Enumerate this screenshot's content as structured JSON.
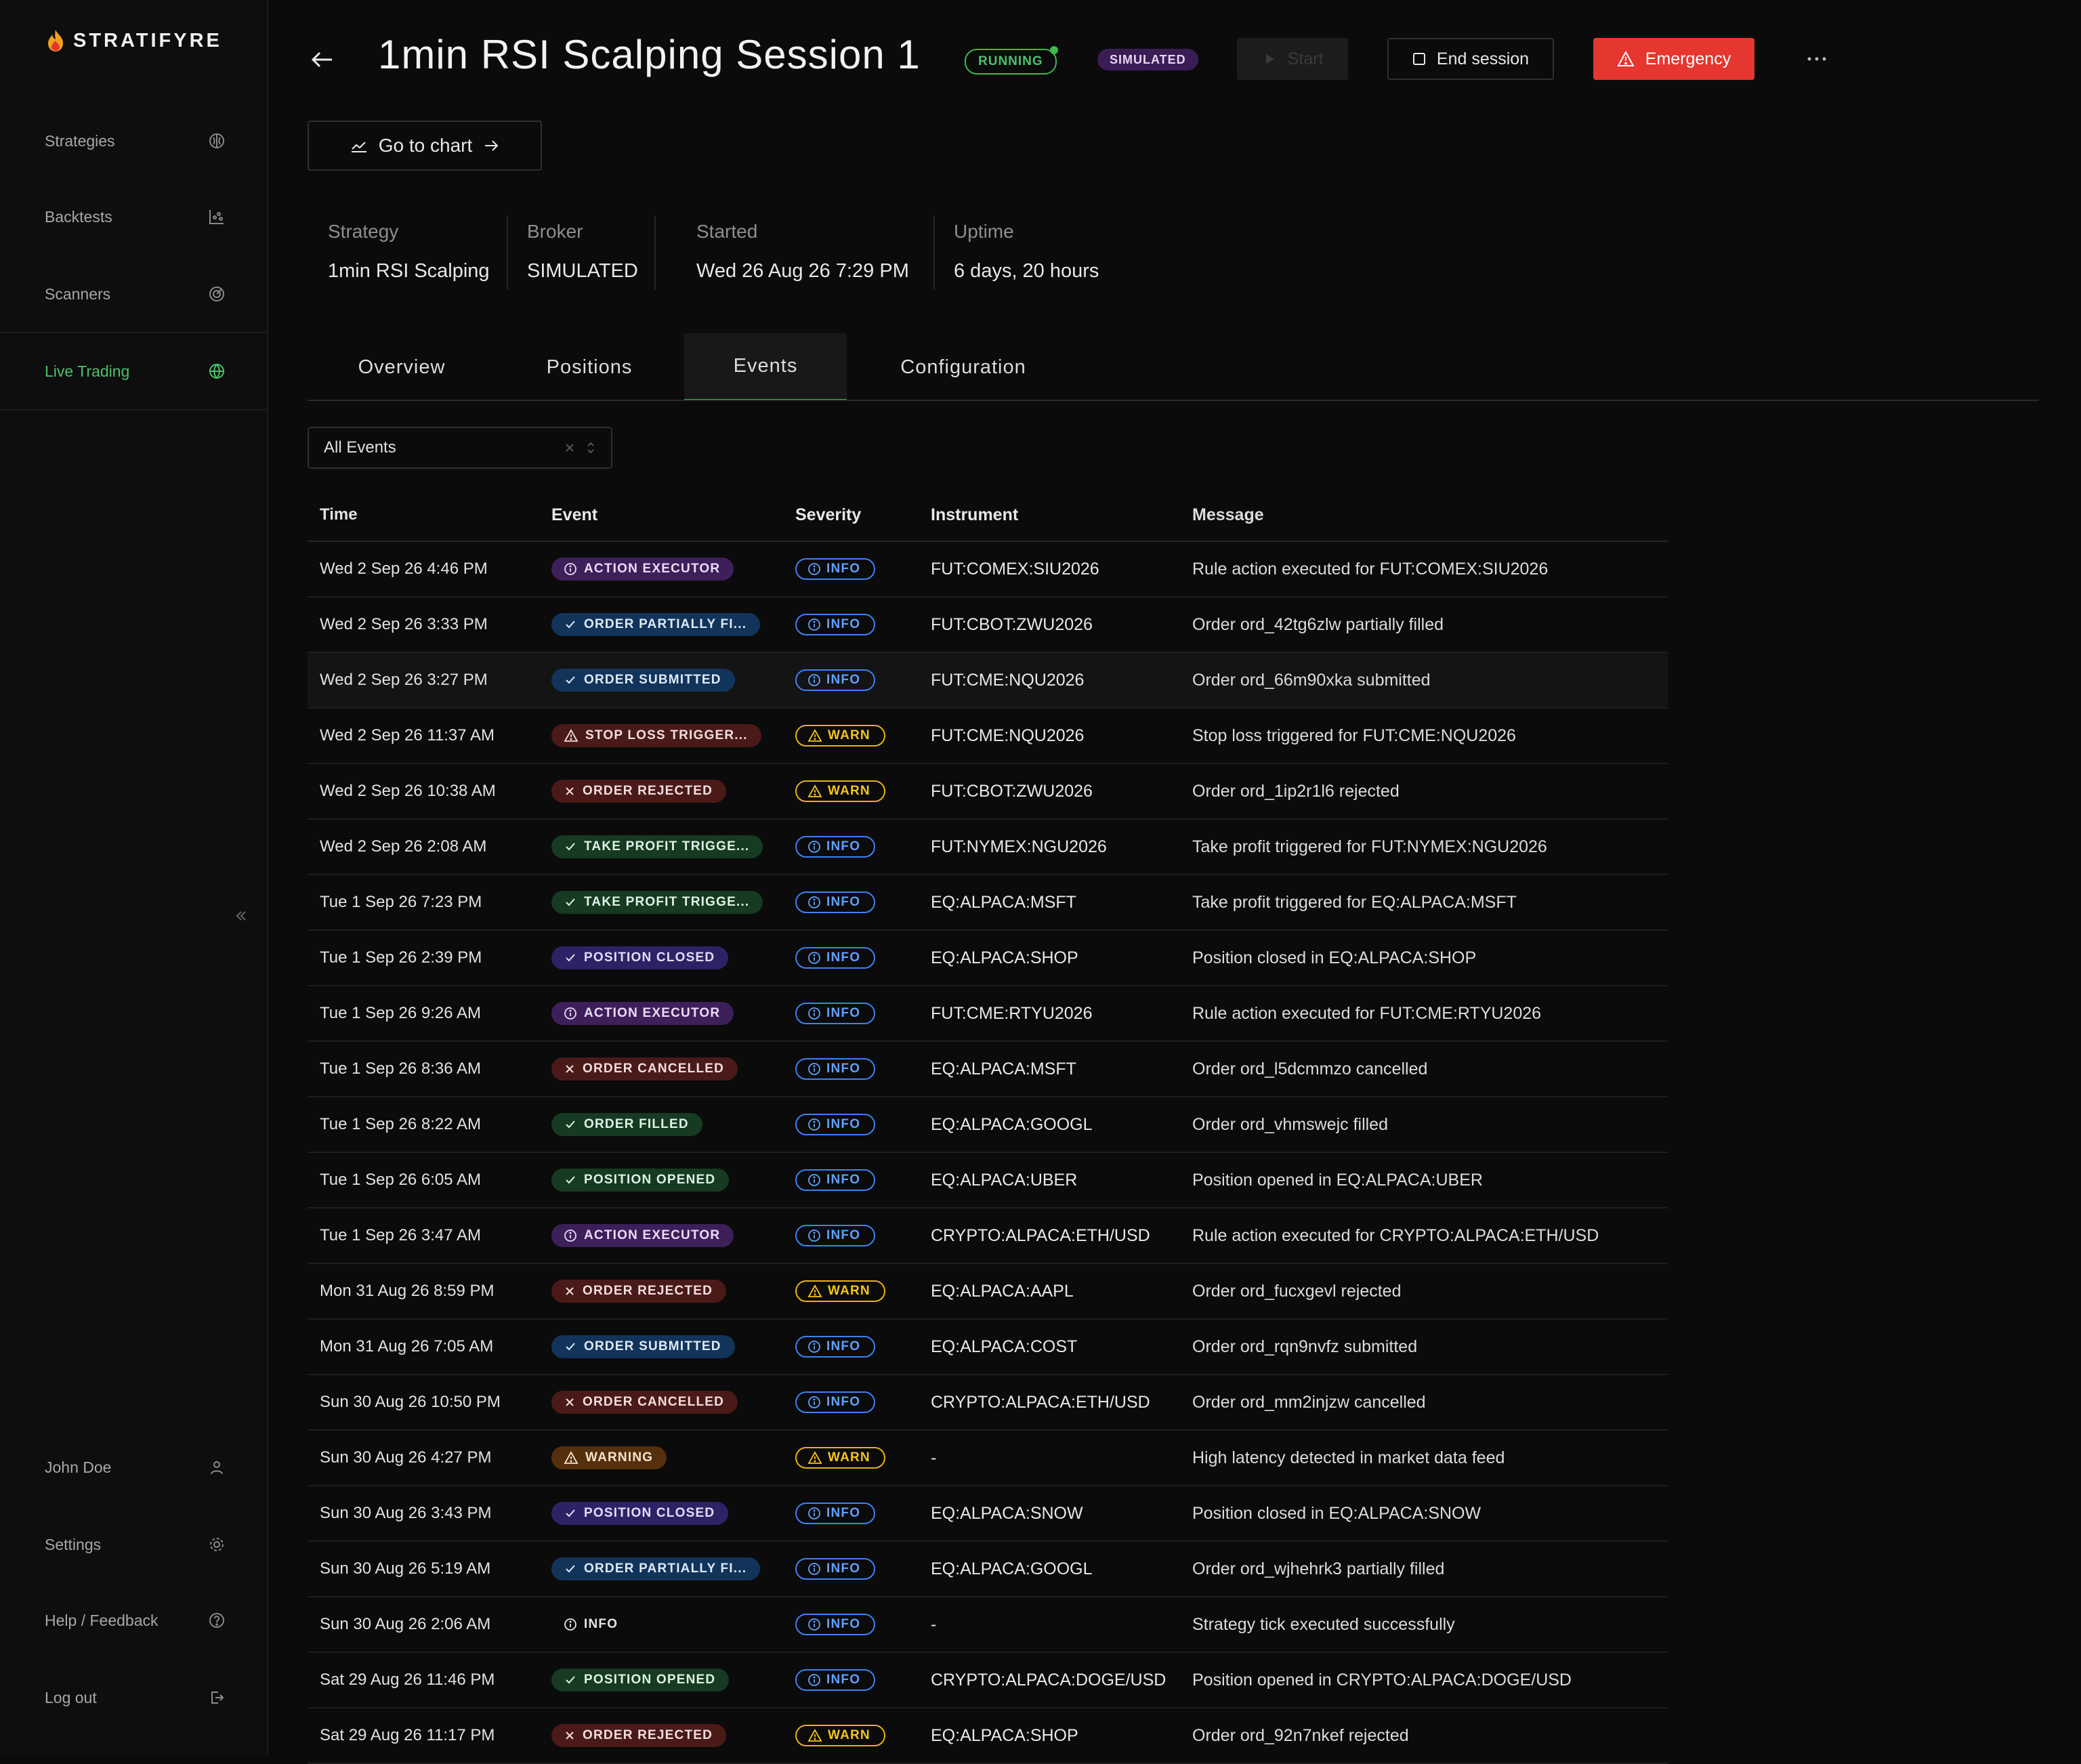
{
  "app": {
    "brand": "STRATIFYRE",
    "accent": "#3fb950",
    "danger": "#e5362f"
  },
  "sidebar": {
    "items": [
      {
        "label": "Strategies",
        "icon": "brain-icon"
      },
      {
        "label": "Backtests",
        "icon": "chart-scatter-icon"
      },
      {
        "label": "Scanners",
        "icon": "radar-icon"
      },
      {
        "label": "Live Trading",
        "icon": "globe-icon",
        "active": true
      }
    ],
    "bottom": [
      {
        "label": "John Doe",
        "icon": "user-icon"
      },
      {
        "label": "Settings",
        "icon": "gear-icon"
      },
      {
        "label": "Help / Feedback",
        "icon": "help-circle-icon"
      },
      {
        "label": "Log out",
        "icon": "logout-icon"
      }
    ]
  },
  "header": {
    "title": "1min RSI Scalping Session 1",
    "status": "RUNNING",
    "mode": "SIMULATED",
    "start_label": "Start",
    "end_label": "End session",
    "emergency_label": "Emergency",
    "chart_label": "Go to chart"
  },
  "info": [
    {
      "label": "Strategy",
      "value": "1min RSI Scalping"
    },
    {
      "label": "Broker",
      "value": "SIMULATED"
    },
    {
      "label": "Started",
      "value": "Wed 26 Aug 26 7:29 PM"
    },
    {
      "label": "Uptime",
      "value": "6 days, 20 hours"
    }
  ],
  "tabs": [
    "Overview",
    "Positions",
    "Events",
    "Configuration"
  ],
  "active_tab": "Events",
  "filter": {
    "value": "All Events"
  },
  "table": {
    "columns": [
      "Time",
      "Event",
      "Severity",
      "Instrument",
      "Message"
    ],
    "rows": [
      {
        "time": "Wed 2 Sep 26 4:46 PM",
        "event": "ACTION EXECUTOR",
        "kind": "action",
        "severity": "INFO",
        "instrument": "FUT:COMEX:SIU2026",
        "message": "Rule action executed for FUT:COMEX:SIU2026"
      },
      {
        "time": "Wed 2 Sep 26 3:33 PM",
        "event": "ORDER PARTIALLY FI...",
        "kind": "partial",
        "severity": "INFO",
        "instrument": "FUT:CBOT:ZWU2026",
        "message": "Order ord_42tg6zlw partially filled"
      },
      {
        "time": "Wed 2 Sep 26 3:27 PM",
        "event": "ORDER SUBMITTED",
        "kind": "submitted",
        "severity": "INFO",
        "instrument": "FUT:CME:NQU2026",
        "message": "Order ord_66m90xka submitted"
      },
      {
        "time": "Wed 2 Sep 26 11:37 AM",
        "event": "STOP LOSS TRIGGER...",
        "kind": "stoploss",
        "severity": "WARN",
        "instrument": "FUT:CME:NQU2026",
        "message": "Stop loss triggered for FUT:CME:NQU2026"
      },
      {
        "time": "Wed 2 Sep 26 10:38 AM",
        "event": "ORDER REJECTED",
        "kind": "rejected",
        "severity": "WARN",
        "instrument": "FUT:CBOT:ZWU2026",
        "message": "Order ord_1ip2r1l6 rejected"
      },
      {
        "time": "Wed 2 Sep 26 2:08 AM",
        "event": "TAKE PROFIT TRIGGE...",
        "kind": "takeprofit",
        "severity": "INFO",
        "instrument": "FUT:NYMEX:NGU2026",
        "message": "Take profit triggered for FUT:NYMEX:NGU2026"
      },
      {
        "time": "Tue 1 Sep 26 7:23 PM",
        "event": "TAKE PROFIT TRIGGE...",
        "kind": "takeprofit",
        "severity": "INFO",
        "instrument": "EQ:ALPACA:MSFT",
        "message": "Take profit triggered for EQ:ALPACA:MSFT"
      },
      {
        "time": "Tue 1 Sep 26 2:39 PM",
        "event": "POSITION CLOSED",
        "kind": "closed",
        "severity": "INFO",
        "instrument": "EQ:ALPACA:SHOP",
        "message": "Position closed in EQ:ALPACA:SHOP"
      },
      {
        "time": "Tue 1 Sep 26 9:26 AM",
        "event": "ACTION EXECUTOR",
        "kind": "action",
        "severity": "INFO",
        "instrument": "FUT:CME:RTYU2026",
        "message": "Rule action executed for FUT:CME:RTYU2026"
      },
      {
        "time": "Tue 1 Sep 26 8:36 AM",
        "event": "ORDER CANCELLED",
        "kind": "cancelled",
        "severity": "INFO",
        "instrument": "EQ:ALPACA:MSFT",
        "message": "Order ord_l5dcmmzo cancelled"
      },
      {
        "time": "Tue 1 Sep 26 8:22 AM",
        "event": "ORDER FILLED",
        "kind": "filled",
        "severity": "INFO",
        "instrument": "EQ:ALPACA:GOOGL",
        "message": "Order ord_vhmswejc filled"
      },
      {
        "time": "Tue 1 Sep 26 6:05 AM",
        "event": "POSITION OPENED",
        "kind": "opened",
        "severity": "INFO",
        "instrument": "EQ:ALPACA:UBER",
        "message": "Position opened in EQ:ALPACA:UBER"
      },
      {
        "time": "Tue 1 Sep 26 3:47 AM",
        "event": "ACTION EXECUTOR",
        "kind": "action",
        "severity": "INFO",
        "instrument": "CRYPTO:ALPACA:ETH/USD",
        "message": "Rule action executed for CRYPTO:ALPACA:ETH/USD"
      },
      {
        "time": "Mon 31 Aug 26 8:59 PM",
        "event": "ORDER REJECTED",
        "kind": "rejected",
        "severity": "WARN",
        "instrument": "EQ:ALPACA:AAPL",
        "message": "Order ord_fucxgevl rejected"
      },
      {
        "time": "Mon 31 Aug 26 7:05 AM",
        "event": "ORDER SUBMITTED",
        "kind": "submitted",
        "severity": "INFO",
        "instrument": "EQ:ALPACA:COST",
        "message": "Order ord_rqn9nvfz submitted"
      },
      {
        "time": "Sun 30 Aug 26 10:50 PM",
        "event": "ORDER CANCELLED",
        "kind": "cancelled",
        "severity": "INFO",
        "instrument": "CRYPTO:ALPACA:ETH/USD",
        "message": "Order ord_mm2injzw cancelled"
      },
      {
        "time": "Sun 30 Aug 26 4:27 PM",
        "event": "WARNING",
        "kind": "warning",
        "severity": "WARN",
        "instrument": "-",
        "message": "High latency detected in market data feed"
      },
      {
        "time": "Sun 30 Aug 26 3:43 PM",
        "event": "POSITION CLOSED",
        "kind": "closed",
        "severity": "INFO",
        "instrument": "EQ:ALPACA:SNOW",
        "message": "Position closed in EQ:ALPACA:SNOW"
      },
      {
        "time": "Sun 30 Aug 26 5:19 AM",
        "event": "ORDER PARTIALLY FI...",
        "kind": "partial",
        "severity": "INFO",
        "instrument": "EQ:ALPACA:GOOGL",
        "message": "Order ord_wjhehrk3 partially filled"
      },
      {
        "time": "Sun 30 Aug 26 2:06 AM",
        "event": "INFO",
        "kind": "info",
        "severity": "INFO",
        "instrument": "-",
        "message": "Strategy tick executed successfully"
      },
      {
        "time": "Sat 29 Aug 26 11:46 PM",
        "event": "POSITION OPENED",
        "kind": "opened",
        "severity": "INFO",
        "instrument": "CRYPTO:ALPACA:DOGE/USD",
        "message": "Position opened in CRYPTO:ALPACA:DOGE/USD"
      },
      {
        "time": "Sat 29 Aug 26 11:17 PM",
        "event": "ORDER REJECTED",
        "kind": "rejected",
        "severity": "WARN",
        "instrument": "EQ:ALPACA:SHOP",
        "message": "Order ord_92n7nkef rejected"
      }
    ]
  }
}
